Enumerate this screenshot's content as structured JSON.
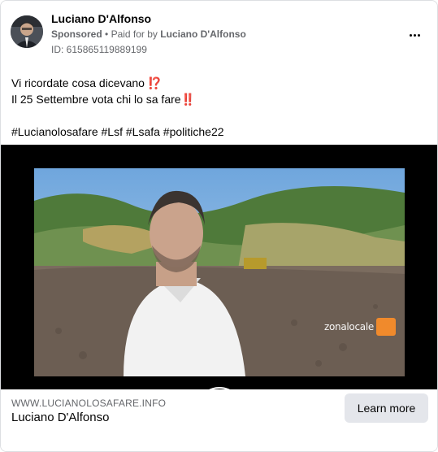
{
  "post": {
    "author": "Luciano D'Alfonso",
    "sponsored_label": "Sponsored",
    "separator": "•",
    "paid_for_prefix": "Paid for by",
    "paid_for_name": "Luciano D'Alfonso",
    "ad_id": "ID: 615865119889199",
    "text_line_1": "Vi ricordate cosa dicevano ⁉️",
    "text_line_2": "Il 25 Settembre vota chi lo sa fare‼️",
    "hashtags": "#Lucianolosafare #Lsf #Lsafa #politiche22"
  },
  "video": {
    "logo_text": "zonalocale",
    "logo_badge": "tv"
  },
  "link_footer": {
    "url": "WWW.LUCIANOLOSAFARE.INFO",
    "title": "Luciano D'Alfonso",
    "cta_label": "Learn more"
  },
  "icons": {
    "more": "more-horizontal-icon",
    "play": "play-icon"
  }
}
